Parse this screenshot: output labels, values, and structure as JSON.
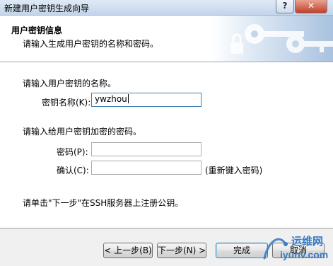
{
  "window": {
    "title": "新建用户密钥生成向导",
    "help_label": "?",
    "close_label": "✕"
  },
  "header": {
    "title": "用户密钥信息",
    "subtitle": "请输入生成用户密钥的名称和密码。"
  },
  "name_section": {
    "heading": "请输入用户密钥的名称。",
    "name_label": "密钥名称(K):",
    "name_value": "ywzhou"
  },
  "password_section": {
    "heading": "请输入给用户密钥加密的密码。",
    "password_label": "密码(P):",
    "password_value": "",
    "confirm_label": "确认(C):",
    "confirm_value": "",
    "confirm_hint": "(重新键入密码)"
  },
  "instruction": "请单击\"下一步\"在SSH服务器上注册公钥。",
  "buttons": {
    "back": "< 上一步(B)",
    "next": "下一步(N) >",
    "finish": "完成",
    "cancel": "取消"
  },
  "watermark": {
    "cn": "运维网",
    "url": "iyunv.com"
  },
  "colors": {
    "header_gradient_end": "#a9c2df",
    "watermark": "#3a7bc4",
    "close_button": "#c2402a"
  }
}
